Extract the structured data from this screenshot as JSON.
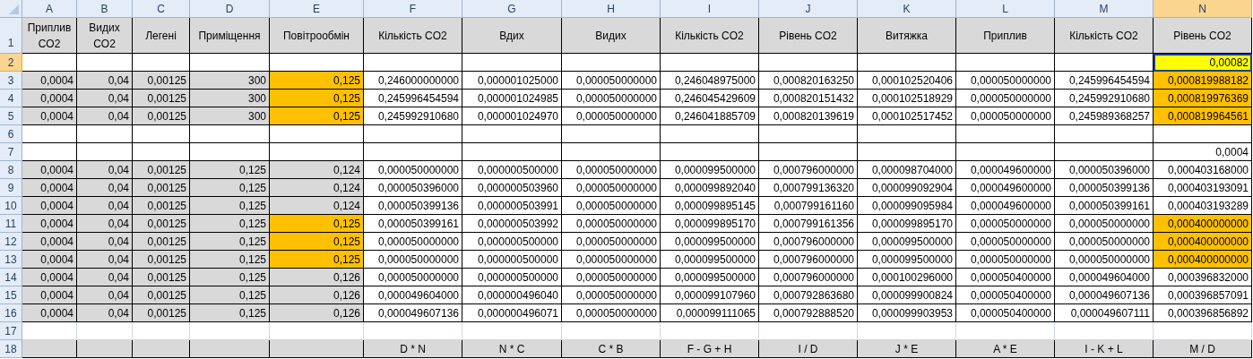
{
  "columns": [
    {
      "letter": "A",
      "selected": false
    },
    {
      "letter": "B",
      "selected": false
    },
    {
      "letter": "C",
      "selected": false
    },
    {
      "letter": "D",
      "selected": false
    },
    {
      "letter": "E",
      "selected": false
    },
    {
      "letter": "F",
      "selected": false
    },
    {
      "letter": "G",
      "selected": false
    },
    {
      "letter": "H",
      "selected": false
    },
    {
      "letter": "I",
      "selected": false
    },
    {
      "letter": "J",
      "selected": false
    },
    {
      "letter": "K",
      "selected": false
    },
    {
      "letter": "L",
      "selected": false
    },
    {
      "letter": "M",
      "selected": false
    },
    {
      "letter": "N",
      "selected": true
    }
  ],
  "rows": [
    {
      "number": "1",
      "selected": false,
      "kind": "header",
      "cells": [
        {
          "text": "Приплив CO2",
          "color": "#d9d9d9"
        },
        {
          "text": "Видих CO2",
          "color": "#d9d9d9"
        },
        {
          "text": "Легені",
          "color": "#d9d9d9"
        },
        {
          "text": "Приміщення",
          "color": "#d9d9d9"
        },
        {
          "text": "Повітрообмін",
          "color": "#d9d9d9"
        },
        {
          "text": "Кількість CO2",
          "color": "#d9d9d9"
        },
        {
          "text": "Вдих",
          "color": "#d9d9d9"
        },
        {
          "text": "Видих",
          "color": "#d9d9d9"
        },
        {
          "text": "Кількість CO2",
          "color": "#d9d9d9"
        },
        {
          "text": "Рівень CO2",
          "color": "#d9d9d9"
        },
        {
          "text": "Витяжка",
          "color": "#d9d9d9"
        },
        {
          "text": "Приплив",
          "color": "#d9d9d9"
        },
        {
          "text": "Кількість CO2",
          "color": "#d9d9d9"
        },
        {
          "text": "Рівень CO2",
          "color": "#d9d9d9"
        }
      ]
    },
    {
      "number": "2",
      "selected": true,
      "kind": "data",
      "cells": [
        {},
        {},
        {},
        {},
        {},
        {},
        {},
        {},
        {},
        {},
        {},
        {},
        {},
        {
          "text": "0,00082",
          "color": "#ffff00"
        }
      ]
    },
    {
      "number": "3",
      "selected": false,
      "kind": "data",
      "cells": [
        {
          "text": "0,0004",
          "color": "#d9d9d9"
        },
        {
          "text": "0,04",
          "color": "#d9d9d9"
        },
        {
          "text": "0,00125",
          "color": "#d9d9d9"
        },
        {
          "text": "300",
          "color": "#d9d9d9"
        },
        {
          "text": "0,125",
          "color": "#ffc000"
        },
        {
          "text": "0,246000000000"
        },
        {
          "text": "0,000001025000"
        },
        {
          "text": "0,000050000000"
        },
        {
          "text": "0,246048975000"
        },
        {
          "text": "0,000820163250"
        },
        {
          "text": "0,000102520406"
        },
        {
          "text": "0,000050000000"
        },
        {
          "text": "0,245996454594"
        },
        {
          "text": "0,000819988182",
          "color": "#ffc000"
        }
      ]
    },
    {
      "number": "4",
      "selected": false,
      "kind": "data",
      "cells": [
        {
          "text": "0,0004",
          "color": "#d9d9d9"
        },
        {
          "text": "0,04",
          "color": "#d9d9d9"
        },
        {
          "text": "0,00125",
          "color": "#d9d9d9"
        },
        {
          "text": "300",
          "color": "#d9d9d9"
        },
        {
          "text": "0,125",
          "color": "#ffc000"
        },
        {
          "text": "0,245996454594"
        },
        {
          "text": "0,000001024985"
        },
        {
          "text": "0,000050000000"
        },
        {
          "text": "0,246045429609"
        },
        {
          "text": "0,000820151432"
        },
        {
          "text": "0,000102518929"
        },
        {
          "text": "0,000050000000"
        },
        {
          "text": "0,245992910680"
        },
        {
          "text": "0,000819976369",
          "color": "#ffc000"
        }
      ]
    },
    {
      "number": "5",
      "selected": false,
      "kind": "data",
      "cells": [
        {
          "text": "0,0004",
          "color": "#d9d9d9"
        },
        {
          "text": "0,04",
          "color": "#d9d9d9"
        },
        {
          "text": "0,00125",
          "color": "#d9d9d9"
        },
        {
          "text": "300",
          "color": "#d9d9d9"
        },
        {
          "text": "0,125",
          "color": "#ffc000"
        },
        {
          "text": "0,245992910680"
        },
        {
          "text": "0,000001024970"
        },
        {
          "text": "0,000050000000"
        },
        {
          "text": "0,246041885709"
        },
        {
          "text": "0,000820139619"
        },
        {
          "text": "0,000102517452"
        },
        {
          "text": "0,000050000000"
        },
        {
          "text": "0,245989368257"
        },
        {
          "text": "0,000819964561",
          "color": "#ffc000"
        }
      ]
    },
    {
      "number": "6",
      "selected": false,
      "kind": "data",
      "cells": [
        {},
        {},
        {},
        {},
        {},
        {},
        {},
        {},
        {},
        {},
        {},
        {},
        {},
        {}
      ]
    },
    {
      "number": "7",
      "selected": false,
      "kind": "data",
      "cells": [
        {},
        {},
        {},
        {},
        {},
        {},
        {},
        {},
        {},
        {},
        {},
        {},
        {},
        {
          "text": "0,0004"
        }
      ]
    },
    {
      "number": "8",
      "selected": false,
      "kind": "data",
      "cells": [
        {
          "text": "0,0004",
          "color": "#d9d9d9"
        },
        {
          "text": "0,04",
          "color": "#d9d9d9"
        },
        {
          "text": "0,00125",
          "color": "#d9d9d9"
        },
        {
          "text": "0,125",
          "color": "#d9d9d9"
        },
        {
          "text": "0,124",
          "color": "#d9d9d9"
        },
        {
          "text": "0,000050000000"
        },
        {
          "text": "0,000000500000"
        },
        {
          "text": "0,000050000000"
        },
        {
          "text": "0,000099500000"
        },
        {
          "text": "0,000796000000"
        },
        {
          "text": "0,000098704000"
        },
        {
          "text": "0,000049600000"
        },
        {
          "text": "0,000050396000"
        },
        {
          "text": "0,000403168000"
        }
      ]
    },
    {
      "number": "9",
      "selected": false,
      "kind": "data",
      "cells": [
        {
          "text": "0,0004",
          "color": "#d9d9d9"
        },
        {
          "text": "0,04",
          "color": "#d9d9d9"
        },
        {
          "text": "0,00125",
          "color": "#d9d9d9"
        },
        {
          "text": "0,125",
          "color": "#d9d9d9"
        },
        {
          "text": "0,124",
          "color": "#d9d9d9"
        },
        {
          "text": "0,000050396000"
        },
        {
          "text": "0,000000503960"
        },
        {
          "text": "0,000050000000"
        },
        {
          "text": "0,000099892040"
        },
        {
          "text": "0,000799136320"
        },
        {
          "text": "0,000099092904"
        },
        {
          "text": "0,000049600000"
        },
        {
          "text": "0,000050399136"
        },
        {
          "text": "0,000403193091"
        }
      ]
    },
    {
      "number": "10",
      "selected": false,
      "kind": "data",
      "cells": [
        {
          "text": "0,0004",
          "color": "#d9d9d9"
        },
        {
          "text": "0,04",
          "color": "#d9d9d9"
        },
        {
          "text": "0,00125",
          "color": "#d9d9d9"
        },
        {
          "text": "0,125",
          "color": "#d9d9d9"
        },
        {
          "text": "0,124",
          "color": "#d9d9d9"
        },
        {
          "text": "0,000050399136"
        },
        {
          "text": "0,000000503991"
        },
        {
          "text": "0,000050000000"
        },
        {
          "text": "0,000099895145"
        },
        {
          "text": "0,000799161160"
        },
        {
          "text": "0,000099095984"
        },
        {
          "text": "0,000049600000"
        },
        {
          "text": "0,000050399161"
        },
        {
          "text": "0,000403193289"
        }
      ]
    },
    {
      "number": "11",
      "selected": false,
      "kind": "data",
      "cells": [
        {
          "text": "0,0004",
          "color": "#d9d9d9"
        },
        {
          "text": "0,04",
          "color": "#d9d9d9"
        },
        {
          "text": "0,00125",
          "color": "#d9d9d9"
        },
        {
          "text": "0,125",
          "color": "#d9d9d9"
        },
        {
          "text": "0,125",
          "color": "#ffc000"
        },
        {
          "text": "0,000050399161"
        },
        {
          "text": "0,000000503992"
        },
        {
          "text": "0,000050000000"
        },
        {
          "text": "0,000099895170"
        },
        {
          "text": "0,000799161356"
        },
        {
          "text": "0,000099895170"
        },
        {
          "text": "0,000050000000"
        },
        {
          "text": "0,000050000000"
        },
        {
          "text": "0,000400000000",
          "color": "#ffc000"
        }
      ]
    },
    {
      "number": "12",
      "selected": false,
      "kind": "data",
      "cells": [
        {
          "text": "0,0004",
          "color": "#d9d9d9"
        },
        {
          "text": "0,04",
          "color": "#d9d9d9"
        },
        {
          "text": "0,00125",
          "color": "#d9d9d9"
        },
        {
          "text": "0,125",
          "color": "#d9d9d9"
        },
        {
          "text": "0,125",
          "color": "#ffc000"
        },
        {
          "text": "0,000050000000"
        },
        {
          "text": "0,000000500000"
        },
        {
          "text": "0,000050000000"
        },
        {
          "text": "0,000099500000"
        },
        {
          "text": "0,000796000000"
        },
        {
          "text": "0,000099500000"
        },
        {
          "text": "0,000050000000"
        },
        {
          "text": "0,000050000000"
        },
        {
          "text": "0,000400000000",
          "color": "#ffc000"
        }
      ]
    },
    {
      "number": "13",
      "selected": false,
      "kind": "data",
      "cells": [
        {
          "text": "0,0004",
          "color": "#d9d9d9"
        },
        {
          "text": "0,04",
          "color": "#d9d9d9"
        },
        {
          "text": "0,00125",
          "color": "#d9d9d9"
        },
        {
          "text": "0,125",
          "color": "#d9d9d9"
        },
        {
          "text": "0,125",
          "color": "#ffc000"
        },
        {
          "text": "0,000050000000"
        },
        {
          "text": "0,000000500000"
        },
        {
          "text": "0,000050000000"
        },
        {
          "text": "0,000099500000"
        },
        {
          "text": "0,000796000000"
        },
        {
          "text": "0,000099500000"
        },
        {
          "text": "0,000050000000"
        },
        {
          "text": "0,000050000000"
        },
        {
          "text": "0,000400000000",
          "color": "#ffc000"
        }
      ]
    },
    {
      "number": "14",
      "selected": false,
      "kind": "data",
      "cells": [
        {
          "text": "0,0004",
          "color": "#d9d9d9"
        },
        {
          "text": "0,04",
          "color": "#d9d9d9"
        },
        {
          "text": "0,00125",
          "color": "#d9d9d9"
        },
        {
          "text": "0,125",
          "color": "#d9d9d9"
        },
        {
          "text": "0,126",
          "color": "#d9d9d9"
        },
        {
          "text": "0,000050000000"
        },
        {
          "text": "0,000000500000"
        },
        {
          "text": "0,000050000000"
        },
        {
          "text": "0,000099500000"
        },
        {
          "text": "0,000796000000"
        },
        {
          "text": "0,000100296000"
        },
        {
          "text": "0,000050400000"
        },
        {
          "text": "0,000049604000"
        },
        {
          "text": "0,000396832000"
        }
      ]
    },
    {
      "number": "15",
      "selected": false,
      "kind": "data",
      "cells": [
        {
          "text": "0,0004",
          "color": "#d9d9d9"
        },
        {
          "text": "0,04",
          "color": "#d9d9d9"
        },
        {
          "text": "0,00125",
          "color": "#d9d9d9"
        },
        {
          "text": "0,125",
          "color": "#d9d9d9"
        },
        {
          "text": "0,126",
          "color": "#d9d9d9"
        },
        {
          "text": "0,000049604000"
        },
        {
          "text": "0,000000496040"
        },
        {
          "text": "0,000050000000"
        },
        {
          "text": "0,000099107960"
        },
        {
          "text": "0,000792863680"
        },
        {
          "text": "0,000099900824"
        },
        {
          "text": "0,000050400000"
        },
        {
          "text": "0,000049607136"
        },
        {
          "text": "0,000396857091"
        }
      ]
    },
    {
      "number": "16",
      "selected": false,
      "kind": "data",
      "cells": [
        {
          "text": "0,0004",
          "color": "#d9d9d9"
        },
        {
          "text": "0,04",
          "color": "#d9d9d9"
        },
        {
          "text": "0,00125",
          "color": "#d9d9d9"
        },
        {
          "text": "0,125",
          "color": "#d9d9d9"
        },
        {
          "text": "0,126",
          "color": "#d9d9d9"
        },
        {
          "text": "0,000049607136"
        },
        {
          "text": "0,000000496071"
        },
        {
          "text": "0,000050000000"
        },
        {
          "text": "0,000099111065"
        },
        {
          "text": "0,000792888520"
        },
        {
          "text": "0,000099903953"
        },
        {
          "text": "0,000050400000"
        },
        {
          "text": "0,000049607111"
        },
        {
          "text": "0,000396856892"
        }
      ]
    },
    {
      "number": "17",
      "selected": false,
      "kind": "blank",
      "cells": [
        {},
        {},
        {},
        {},
        {},
        {},
        {},
        {},
        {},
        {},
        {},
        {},
        {},
        {}
      ]
    },
    {
      "number": "18",
      "selected": false,
      "kind": "formula",
      "cells": [
        {
          "color": "#d9d9d9"
        },
        {
          "color": "#d9d9d9"
        },
        {
          "color": "#d9d9d9"
        },
        {
          "color": "#d9d9d9"
        },
        {
          "color": "#d9d9d9"
        },
        {
          "text": "D * N",
          "color": "#d9d9d9"
        },
        {
          "text": "N * C",
          "color": "#d9d9d9"
        },
        {
          "text": "C * B",
          "color": "#d9d9d9"
        },
        {
          "text": "F - G + H",
          "color": "#d9d9d9"
        },
        {
          "text": "I / D",
          "color": "#d9d9d9"
        },
        {
          "text": "J * E",
          "color": "#d9d9d9"
        },
        {
          "text": "A * E",
          "color": "#d9d9d9"
        },
        {
          "text": "I - K + L",
          "color": "#d9d9d9"
        },
        {
          "text": "M / D",
          "color": "#d9d9d9"
        }
      ]
    }
  ]
}
